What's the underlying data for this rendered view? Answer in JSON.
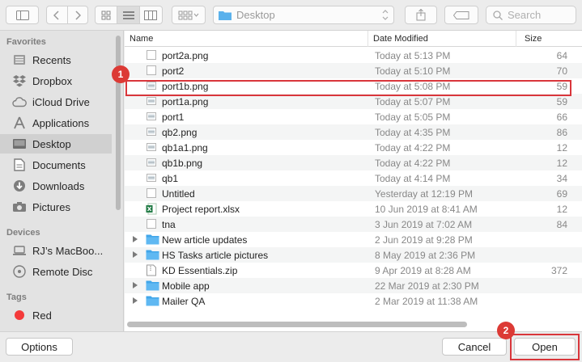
{
  "toolbar": {
    "location": "Desktop",
    "search_placeholder": "Search"
  },
  "sidebar": {
    "sections": [
      {
        "heading": "Favorites",
        "items": [
          {
            "label": "Recents",
            "icon": "clock-icon"
          },
          {
            "label": "Dropbox",
            "icon": "dropbox-icon"
          },
          {
            "label": "iCloud Drive",
            "icon": "cloud-icon"
          },
          {
            "label": "Applications",
            "icon": "applications-icon"
          },
          {
            "label": "Desktop",
            "icon": "desktop-icon",
            "selected": true
          },
          {
            "label": "Documents",
            "icon": "documents-icon"
          },
          {
            "label": "Downloads",
            "icon": "downloads-icon"
          },
          {
            "label": "Pictures",
            "icon": "camera-icon"
          }
        ]
      },
      {
        "heading": "Devices",
        "items": [
          {
            "label": "RJ’s MacBoo...",
            "icon": "laptop-icon"
          },
          {
            "label": "Remote Disc",
            "icon": "disc-icon"
          }
        ]
      },
      {
        "heading": "Tags",
        "items": [
          {
            "label": "Red",
            "icon": "red-tag-icon"
          }
        ]
      }
    ]
  },
  "columns": {
    "name": "Name",
    "date": "Date Modified",
    "size": "Size"
  },
  "files": [
    {
      "name": "port2a.png",
      "date": "Today at 5:13 PM",
      "size": "64",
      "icon": "document-icon"
    },
    {
      "name": "port2",
      "date": "Today at 5:10 PM",
      "size": "70",
      "icon": "document-icon"
    },
    {
      "name": "port1b.png",
      "date": "Today at 5:08 PM",
      "size": "59",
      "icon": "image-icon",
      "highlighted": true
    },
    {
      "name": "port1a.png",
      "date": "Today at 5:07 PM",
      "size": "59",
      "icon": "image-icon"
    },
    {
      "name": "port1",
      "date": "Today at 5:05 PM",
      "size": "66",
      "icon": "image-icon"
    },
    {
      "name": "qb2.png",
      "date": "Today at 4:35 PM",
      "size": "86",
      "icon": "image-icon"
    },
    {
      "name": "qb1a1.png",
      "date": "Today at 4:22 PM",
      "size": "12",
      "icon": "image-icon"
    },
    {
      "name": "qb1b.png",
      "date": "Today at 4:22 PM",
      "size": "12",
      "icon": "image-icon"
    },
    {
      "name": "qb1",
      "date": "Today at 4:14 PM",
      "size": "34",
      "icon": "image-icon"
    },
    {
      "name": "Untitled",
      "date": "Yesterday at 12:19 PM",
      "size": "69",
      "icon": "document-icon"
    },
    {
      "name": "Project report.xlsx",
      "date": "10 Jun 2019 at 8:41 AM",
      "size": "12",
      "icon": "excel-icon"
    },
    {
      "name": "tna",
      "date": "3 Jun 2019 at 7:02 AM",
      "size": "84",
      "icon": "document-icon"
    },
    {
      "name": "New article updates",
      "date": "2 Jun 2019 at 9:28 PM",
      "size": "",
      "icon": "folder-icon",
      "folder": true
    },
    {
      "name": "HS Tasks article pictures",
      "date": "8 May 2019 at 2:36 PM",
      "size": "",
      "icon": "folder-icon",
      "folder": true
    },
    {
      "name": "KD Essentials.zip",
      "date": "9 Apr 2019 at 8:28 AM",
      "size": "372",
      "icon": "zip-icon"
    },
    {
      "name": "Mobile app",
      "date": "22 Mar 2019 at 2:30 PM",
      "size": "",
      "icon": "folder-icon",
      "folder": true
    },
    {
      "name": "Mailer QA",
      "date": "2 Mar 2019 at 11:38 AM",
      "size": "",
      "icon": "folder-icon",
      "folder": true
    }
  ],
  "buttons": {
    "options": "Options",
    "cancel": "Cancel",
    "open": "Open"
  },
  "markers": [
    "1",
    "2"
  ],
  "colors": {
    "highlight": "#d9363b",
    "folder": "#41a6e9",
    "excel": "#1f7a43"
  }
}
